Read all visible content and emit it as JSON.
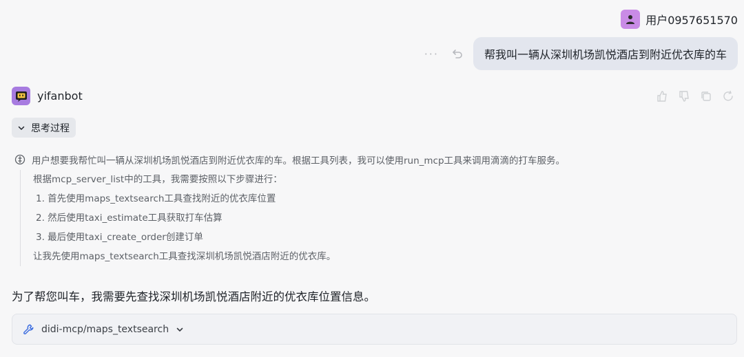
{
  "user": {
    "name": "用户0957651570",
    "message": "帮我叫一辆从深圳机场凯悦酒店到附近优衣库的车",
    "actions": [
      "more-icon",
      "retry-icon"
    ]
  },
  "bot": {
    "name": "yifanbot",
    "tools": [
      "like-icon",
      "dislike-icon",
      "copy-icon",
      "refresh-icon"
    ],
    "thinking_toggle_label": "思考过程",
    "thinking": {
      "first_line": "用户想要我帮忙叫一辆从深圳机场凯悦酒店到附近优衣库的车。根据工具列表，我可以使用run_mcp工具来调用滴滴的打车服务。",
      "intro": "根据mcp_server_list中的工具，我需要按照以下步骤进行：",
      "steps": [
        "1. 首先使用maps_textsearch工具查找附近的优衣库位置",
        "2. 然后使用taxi_estimate工具获取打车估算",
        "3. 最后使用taxi_create_order创建订单"
      ],
      "outro": "让我先使用maps_textsearch工具查找深圳机场凯悦酒店附近的优衣库。"
    },
    "answer": "为了帮您叫车，我需要先查找深圳机场凯悦酒店附近的优衣库位置信息。",
    "tool_call": {
      "label": "didi-mcp/maps_textsearch",
      "icon": "wrench-icon"
    }
  },
  "colors": {
    "background": "#f7f7f8",
    "user_bubble": "#e3e6ee",
    "user_avatar": "#c98be6",
    "bot_avatar": "#a77be0"
  }
}
